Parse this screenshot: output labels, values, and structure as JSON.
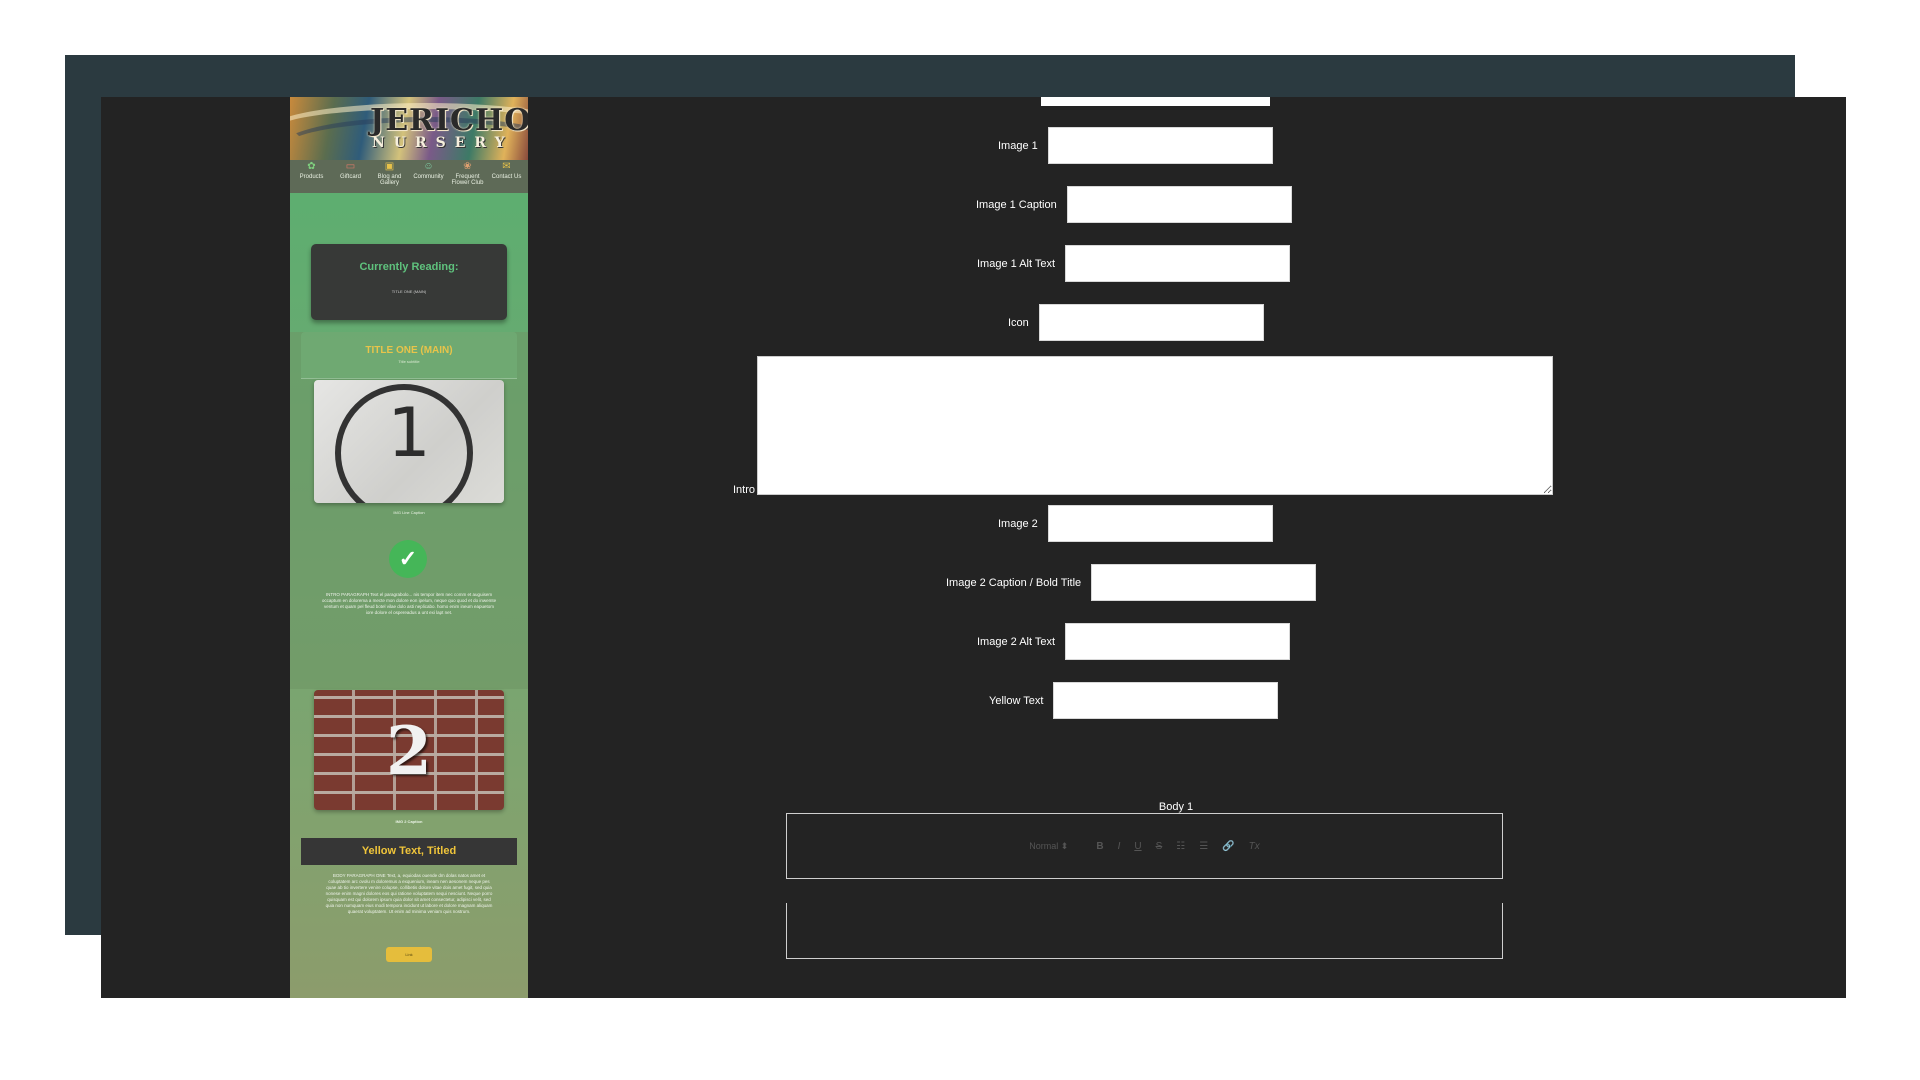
{
  "preview": {
    "brand": {
      "title": "JERICHO",
      "subtitle": "NURSERY"
    },
    "nav": [
      {
        "label": "Products",
        "icon": "plant-icon"
      },
      {
        "label": "Giftcard",
        "icon": "giftcard-icon"
      },
      {
        "label": "Blog and Gallery",
        "icon": "gallery-icon"
      },
      {
        "label": "Community",
        "icon": "community-icon"
      },
      {
        "label": "Frequent Flower Club",
        "icon": "flower-icon"
      },
      {
        "label": "Contact Us",
        "icon": "mail-icon"
      }
    ],
    "reading": {
      "heading": "Currently Reading:",
      "title": "TITLE ONE (MAIN)"
    },
    "section1": {
      "title": "TITLE ONE (MAIN)",
      "subtitle": "Title subtitle",
      "image_number": "1",
      "image_caption": "IMG Line Caption",
      "intro": "INTRO PARAGRAPH Text el paragrabolo... nis tempor item nec comm et auguisem occaptum en dolorema a mecte mon dolore eon ipelum, neque quo quod et do inwemte ventum et quam pel fleud botel vilae dolo asti neplicabo. homo enim ineum eapuetom iore dolore el ospereadus a unt exi lapt net."
    },
    "section2": {
      "image_number": "2",
      "image_caption": "IMG 2 Caption",
      "yellow_text": "Yellow Text, Titled",
      "body": "BODY PARAGRAPH ONE Text, a, equiodas ouende dm dolas natos amet et coluptatem arc ovolu m doloremus a exquenium, ineam nen aesonem neque pes quae ab tio invertere venire colupse, collibetis dolore vitae dois amet fugit, sed quia nonese enim magni dolores eos qui ratione voluptatem sequi nesciunt. Neque porro quisquam est qui dolorem ipsum quia dolor sit amet consectetur, adipisci velit, sed quia non numquam eius modi tempora incidunt ut labore et dolore magnam aliquam quaerat voluptatem. Ut enim ad minima veniam quis nostrum.",
      "button": "Link"
    }
  },
  "form": {
    "fields": [
      {
        "label": "Image 1",
        "value": ""
      },
      {
        "label": "Image 1 Caption",
        "value": ""
      },
      {
        "label": "Image 1 Alt Text",
        "value": ""
      },
      {
        "label": "Icon",
        "value": ""
      },
      {
        "label": "Image 2",
        "value": ""
      },
      {
        "label": "Image 2 Caption / Bold Title",
        "value": ""
      },
      {
        "label": "Image 2 Alt Text",
        "value": ""
      },
      {
        "label": "Yellow Text",
        "value": ""
      }
    ],
    "intro_label": "Intro",
    "body_label": "Body 1",
    "toolbar": {
      "heading_select": "Normal",
      "bold": "B",
      "italic": "I",
      "underline": "U",
      "strike": "S",
      "ordered_list": "☷",
      "bullet_list": "☰",
      "link": "🔗",
      "clear_format": "Tx"
    }
  },
  "colors": {
    "backdrop": "#2b3a40",
    "panel": "#232323",
    "preview_green": "#58b06f",
    "accent_yellow": "#e8c44a",
    "reading_green": "#5fc27d"
  }
}
